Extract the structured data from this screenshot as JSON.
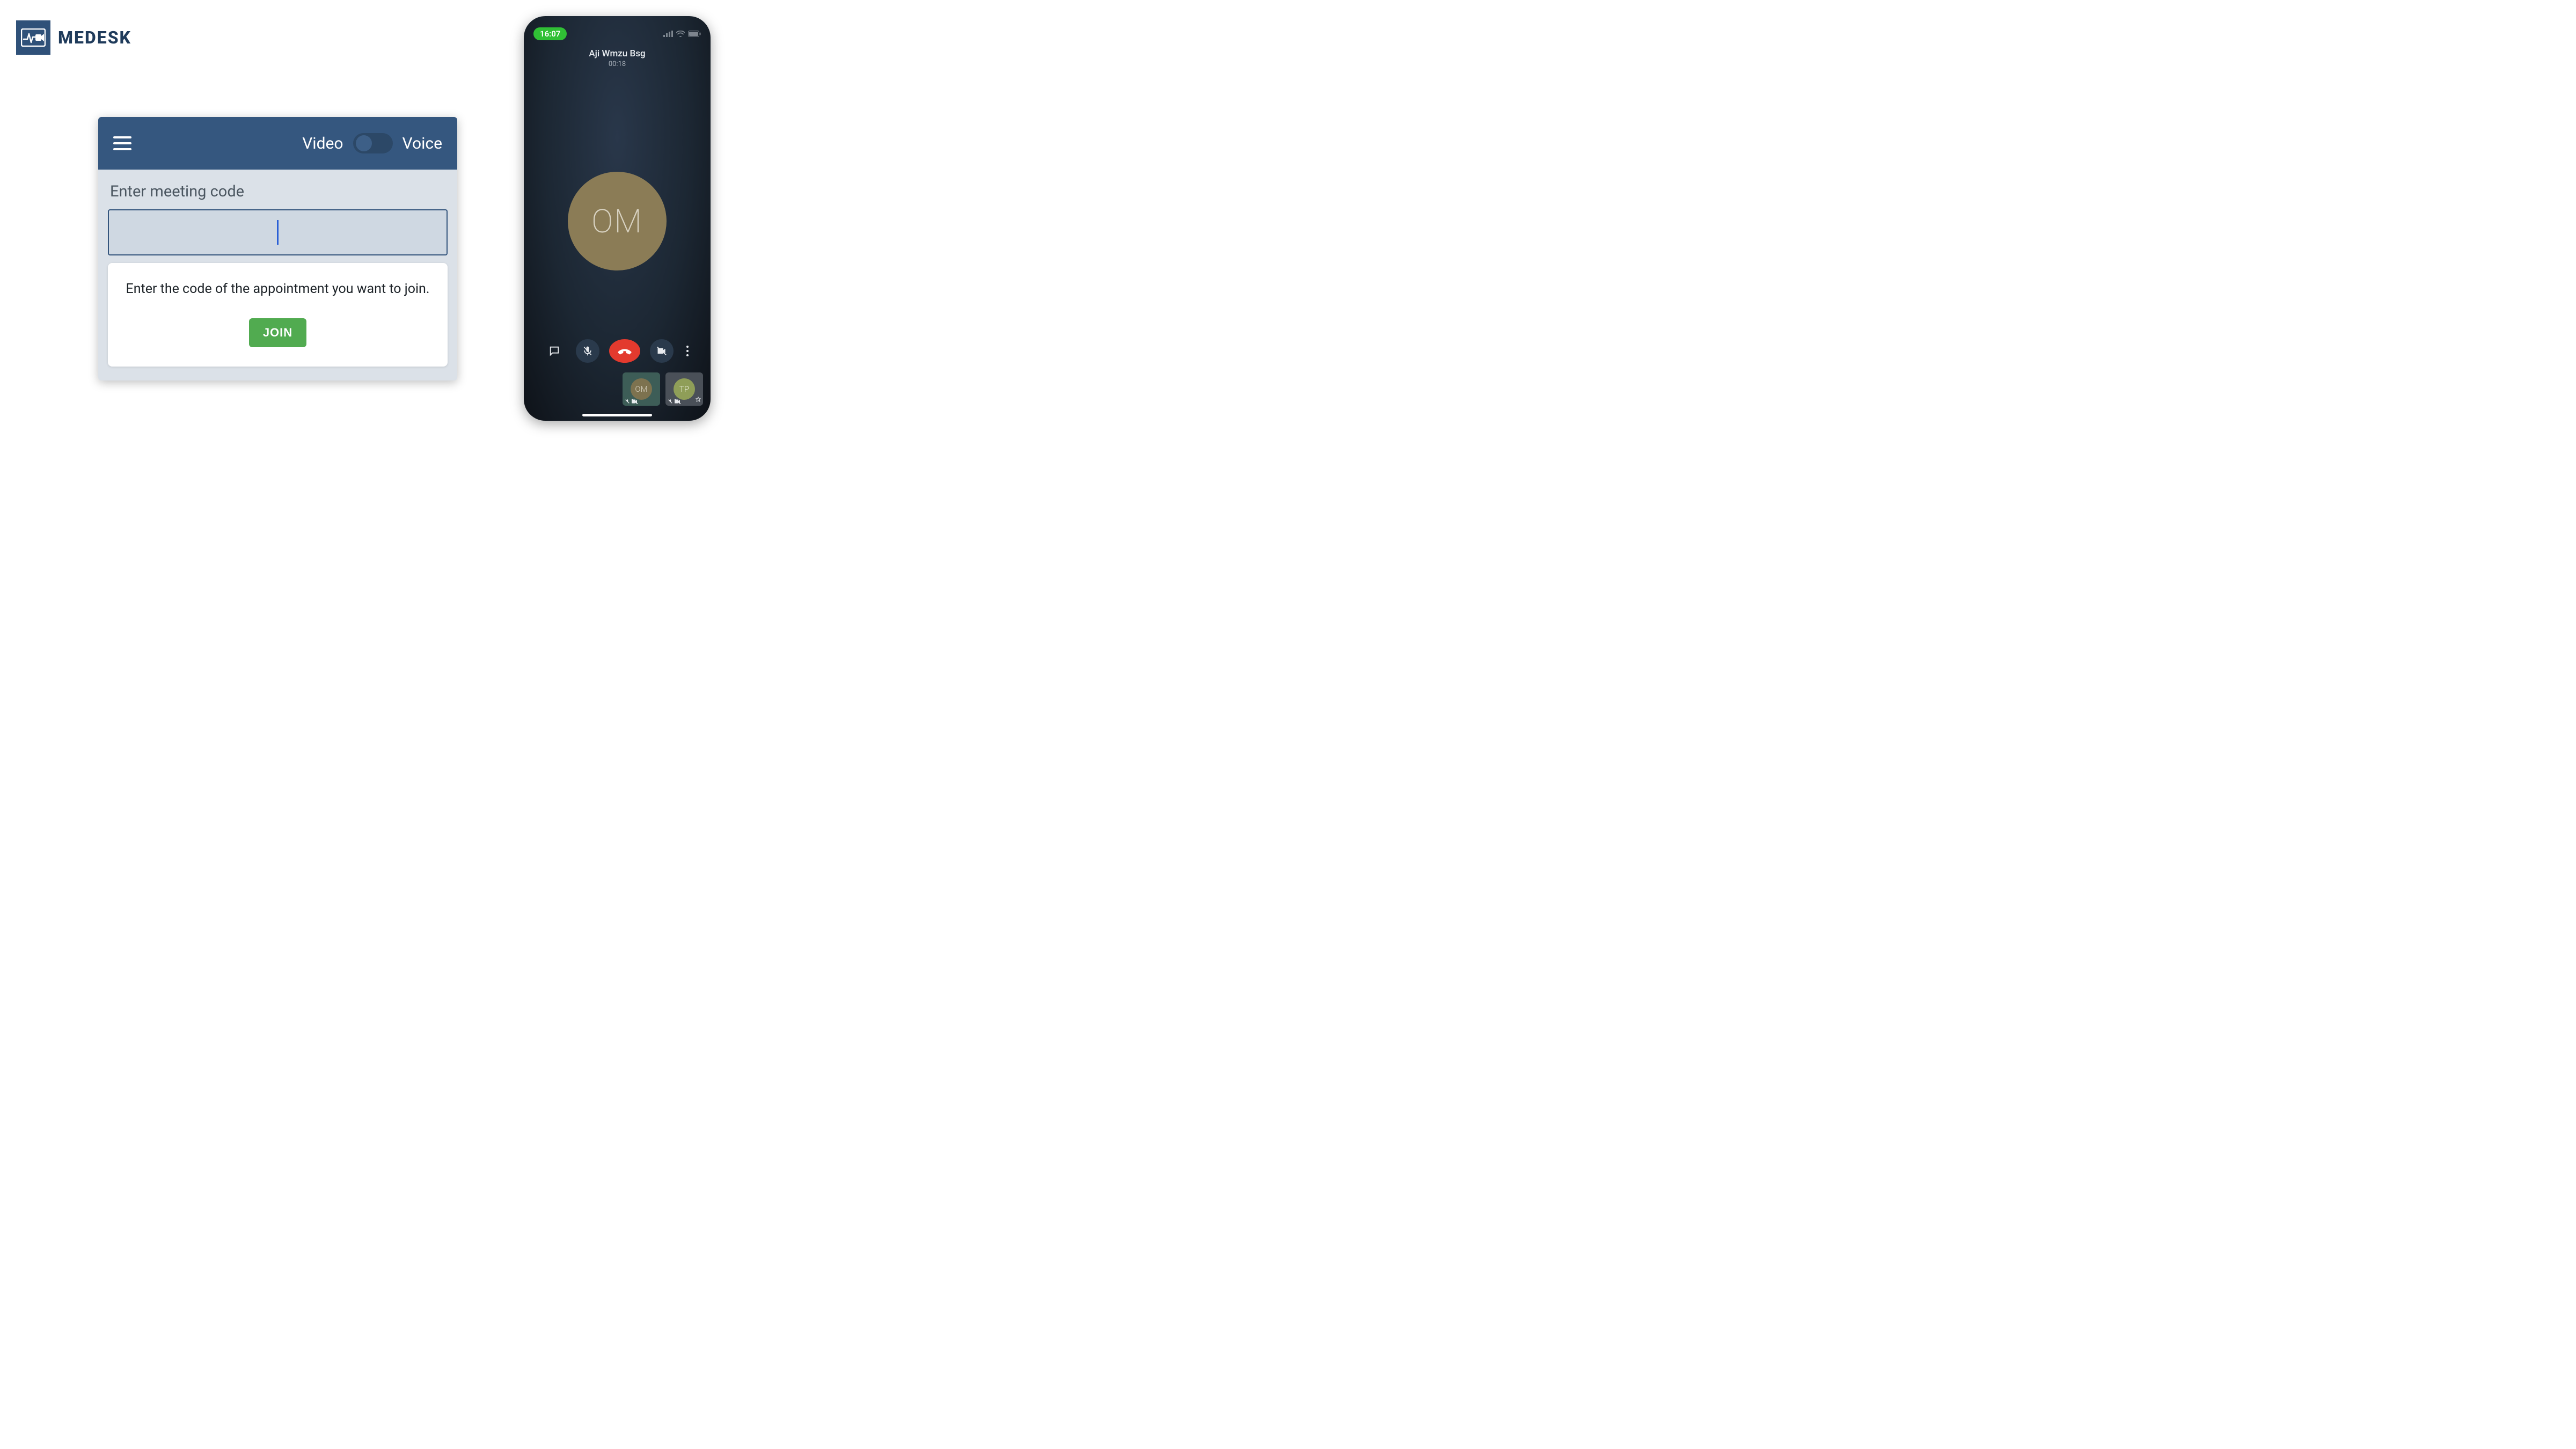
{
  "brand": {
    "name": "MEDESK"
  },
  "panel": {
    "mode_video": "Video",
    "mode_voice": "Voice",
    "label": "Enter meeting code",
    "hint": "Enter the code of the appointment you want to join.",
    "join": "JOIN"
  },
  "phone": {
    "time": "16:07",
    "caller": "Aji Wmzu Bsg",
    "duration": "00:18",
    "avatar_initials": "OM",
    "tiles": [
      {
        "initials": "OM"
      },
      {
        "initials": "TP"
      }
    ]
  }
}
